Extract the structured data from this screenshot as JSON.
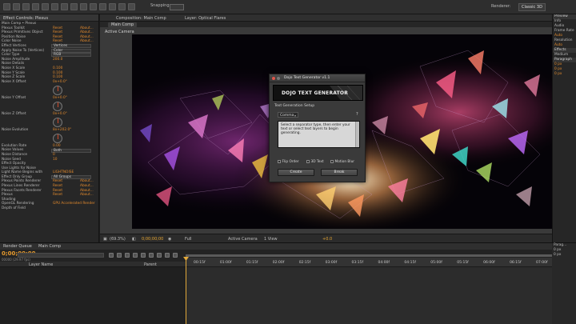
{
  "app": {
    "snapping_label": "Snapping",
    "renderer_label": "Renderer:",
    "workspace": "Classic 3D"
  },
  "left_panel": {
    "tab_title": "Effect Controls: Plexus",
    "breadcrumb": "Main Comp • Plexus",
    "rows": [
      {
        "label": "Plexus Toolkit",
        "v1": "Reset",
        "v2": "About..."
      },
      {
        "label": "Plexus Primitives Object",
        "v1": "Reset",
        "v2": "About..."
      },
      {
        "label": "Position Noise",
        "v1": "Reset",
        "v2": "About..."
      },
      {
        "label": "Color Noise",
        "v1": "Reset",
        "v2": "About..."
      },
      {
        "label": "Effect Vertices",
        "v1": "",
        "v2": "",
        "dd": "Vertices"
      },
      {
        "label": "Apply Noise To (Vertices)",
        "v1": "",
        "v2": "",
        "dd": "Color"
      },
      {
        "label": "Color Type",
        "v1": "",
        "v2": "",
        "dd": "RGB"
      },
      {
        "label": "Noise Amplitude",
        "v1": "200.0",
        "v2": ""
      },
      {
        "label": "Noise Details",
        "v1": "",
        "v2": ""
      },
      {
        "label": "Noise X Scale",
        "v1": "0.100",
        "v2": ""
      },
      {
        "label": "Noise Y Scale",
        "v1": "0.100",
        "v2": ""
      },
      {
        "label": "Noise Z Scale",
        "v1": "0.100",
        "v2": ""
      },
      {
        "label": "Noise X Offset",
        "v1": "0x+0.0°",
        "v2": "",
        "dial": true
      },
      {
        "label": "Noise Y Offset",
        "v1": "0x+0.0°",
        "v2": "",
        "dial": true
      },
      {
        "label": "Noise Z Offset",
        "v1": "0x+0.0°",
        "v2": "",
        "dial": true
      },
      {
        "label": "Noise Evolution",
        "v1": "8x+202.0°",
        "v2": "",
        "dial": true
      },
      {
        "label": "Evolution Rate",
        "v1": "0.00",
        "v2": ""
      },
      {
        "label": "Noise Values",
        "v1": "",
        "v2": "",
        "dd": "Both"
      },
      {
        "label": "Noise Distance",
        "v1": "0",
        "v2": ""
      },
      {
        "label": "Noise Seed",
        "v1": "10",
        "v2": ""
      },
      {
        "label": "Effect Opacity",
        "v1": "",
        "v2": ""
      },
      {
        "label": "Use Lights for Noise",
        "v1": "",
        "v2": ""
      },
      {
        "label": "Light Name Begins with",
        "v1": "LIGHTNOISE",
        "v2": ""
      },
      {
        "label": "Effect Only Group",
        "v1": "",
        "v2": "",
        "dd": "All Groups"
      },
      {
        "label": "Plexus Points Renderer",
        "v1": "Reset",
        "v2": "About..."
      },
      {
        "label": "Plexus Lines Renderer",
        "v1": "Reset",
        "v2": "About..."
      },
      {
        "label": "Plexus Facets Renderer",
        "v1": "Reset",
        "v2": "About..."
      },
      {
        "label": "Plexus",
        "v1": "Reset",
        "v2": "About..."
      },
      {
        "label": "Shading",
        "v1": "",
        "v2": ""
      },
      {
        "label": "OpenGL Rendering",
        "v1": "GPU Accelerated Render",
        "v2": ""
      },
      {
        "label": "Depth of Field",
        "v1": "",
        "v2": ""
      }
    ]
  },
  "comp": {
    "tab_title": "Composition: Main Comp",
    "layer_tab": "Layer: Optical Flares",
    "sub_tab": "Main Comp",
    "view_label": "Active Camera",
    "bar": {
      "zoom": "(69.3%)",
      "time": "0;00;00;00",
      "resolution": "Full",
      "camera": "Active Camera",
      "views": "1 View",
      "exposure": "+0.0"
    }
  },
  "dialog": {
    "title": "Dojo Text Generator v1.1",
    "banner": "DOJO TEXT GENERATOR",
    "section": "Text Generation Setup",
    "separator_value": "Comma",
    "help_icon": "?",
    "instructions": "Select a separator type, then enter your text or select text layers to begin generating.",
    "options": [
      "Flip Order",
      "3D Text",
      "Motion Blur"
    ],
    "create_label": "Create",
    "break_label": "Break"
  },
  "right_panel": {
    "rows": [
      {
        "t": "Preview",
        "hdr": true
      },
      {
        "t": "Info",
        "hdr": false
      },
      {
        "t": "Audio",
        "hdr": false
      },
      {
        "t": "Frame Rate",
        "hdr": false
      },
      {
        "t": "Auto",
        "hdr": false,
        "v": true
      },
      {
        "t": "Resolution",
        "hdr": false
      },
      {
        "t": "Auto",
        "hdr": false,
        "v": true
      },
      {
        "t": "Effects",
        "hdr": true
      },
      {
        "t": "Medium",
        "hdr": false
      },
      {
        "t": "Paragraph",
        "hdr": true
      },
      {
        "t": "0 px",
        "hdr": false,
        "v": true
      },
      {
        "t": "0 px",
        "hdr": false,
        "v": true
      },
      {
        "t": "0 px",
        "hdr": false,
        "v": true
      }
    ]
  },
  "timeline": {
    "tab_title": "Main Comp",
    "render_tab": "Render Queue",
    "timecode": "0;00;00;00",
    "fps": "00000 (29.97 fps)",
    "col_layer": "Layer Name",
    "col_parent": "Parent",
    "ruler": [
      "00:15f",
      "01:00f",
      "01:15f",
      "02:00f",
      "02:15f",
      "03:00f",
      "03:15f",
      "04:00f",
      "04:15f",
      "05:00f",
      "05:15f",
      "06:00f",
      "06:15f",
      "07:00f"
    ],
    "right_rows": [
      "Parag...",
      "0 px",
      "0 px"
    ]
  }
}
